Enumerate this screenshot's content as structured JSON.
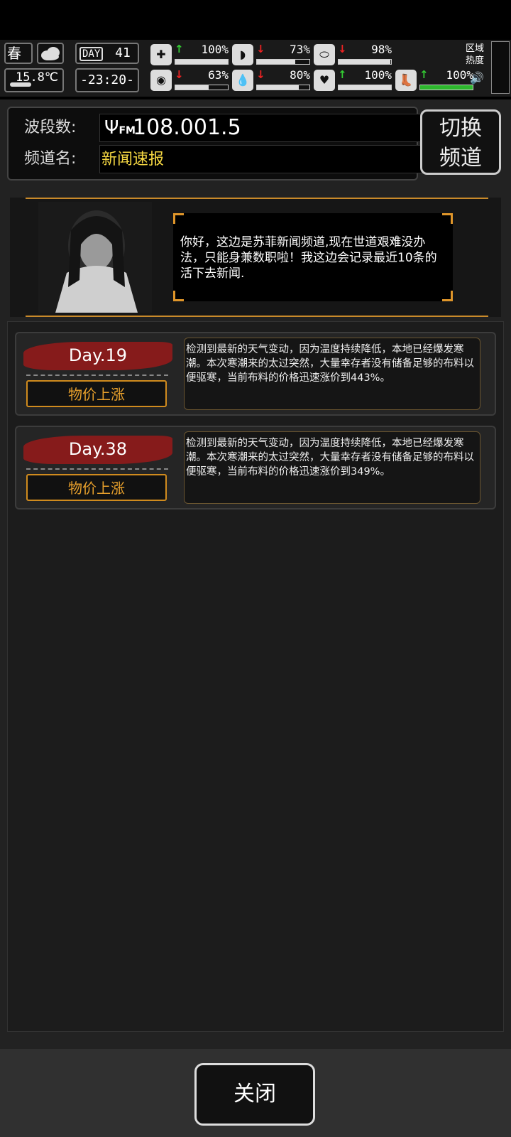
{
  "hud": {
    "season": "春",
    "temperature": "15.8℃",
    "day_tag": "DAY",
    "day_number": "41",
    "clock": "-23:20-",
    "stats": [
      {
        "name": "health",
        "arrow": "up",
        "value": "100%",
        "fill": 1.0
      },
      {
        "name": "hunger",
        "arrow": "down",
        "value": "73%",
        "fill": 0.73
      },
      {
        "name": "energy",
        "arrow": "down",
        "value": "98%",
        "fill": 0.98
      },
      {
        "name": "mind",
        "arrow": "down",
        "value": "63%",
        "fill": 0.63
      },
      {
        "name": "thirst",
        "arrow": "down",
        "value": "80%",
        "fill": 0.8
      },
      {
        "name": "mood",
        "arrow": "up",
        "value": "100%",
        "fill": 1.0
      },
      {
        "name": "stamina",
        "arrow": "up",
        "value": "100%",
        "fill": 1.0
      }
    ],
    "region_label_1": "区域",
    "region_label_2": "热度"
  },
  "tuner": {
    "band_label": "波段数:",
    "band_prefix": "FM",
    "band_value": "108.001.5",
    "channel_label": "频道名:",
    "channel_name": "新闻速报",
    "switch_line1": "切换",
    "switch_line2": "频道"
  },
  "anchor": {
    "message": "你好，这边是苏菲新闻频道,现在世道艰难没办法，只能身兼数职啦！我这边会记录最近10条的活下去新闻."
  },
  "news": [
    {
      "day": "Day.19",
      "tag": "物价上涨",
      "text": "检测到最新的天气变动，因为温度持续降低，本地已经爆发寒潮。本次寒潮来的太过突然，大量幸存者没有储备足够的布料以便驱寒，当前布料的价格迅速涨价到443%。"
    },
    {
      "day": "Day.38",
      "tag": "物价上涨",
      "text": "检测到最新的天气变动，因为温度持续降低，本地已经爆发寒潮。本次寒潮来的太过突然，大量幸存者没有储备足够的布料以便驱寒，当前布料的价格迅速涨价到349%。"
    }
  ],
  "close_label": "关闭",
  "colors": {
    "accent": "#e0962a",
    "channel": "#f5d742",
    "up": "#33cc33",
    "down": "#ee2222"
  }
}
